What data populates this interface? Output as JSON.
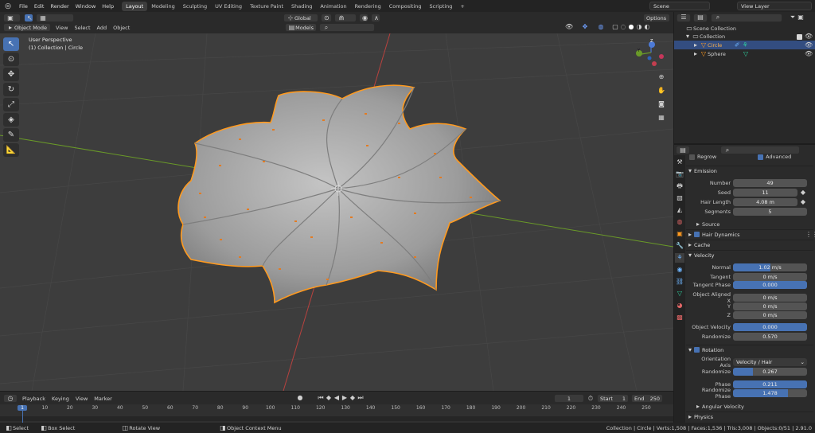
{
  "menubar": {
    "items": [
      "File",
      "Edit",
      "Render",
      "Window",
      "Help"
    ],
    "workspaces": [
      "Layout",
      "Modeling",
      "Sculpting",
      "UV Editing",
      "Texture Paint",
      "Shading",
      "Animation",
      "Rendering",
      "Compositing",
      "Scripting"
    ],
    "active_workspace": "Layout",
    "scene": "Scene",
    "view_layer": "View Layer"
  },
  "viewport_header": {
    "mode": "Object Mode",
    "menus": [
      "View",
      "Select",
      "Add",
      "Object"
    ],
    "orientation": "Global",
    "options": "Options",
    "collection_filter": "Models"
  },
  "viewport": {
    "perspective": "User Perspective",
    "collection_info": "(1) Collection | Circle",
    "gizmo_z": "Z",
    "gizmo_y": "Y"
  },
  "outliner": {
    "root": "Scene Collection",
    "collection": "Collection",
    "objects": [
      "Circle",
      "Sphere"
    ]
  },
  "properties": {
    "regrow": "Regrow",
    "advanced": "Advanced",
    "emission_title": "Emission",
    "emission": [
      {
        "label": "Number",
        "value": "49"
      },
      {
        "label": "Seed",
        "value": "11"
      },
      {
        "label": "Hair Length",
        "value": "4.08 m"
      },
      {
        "label": "Segments",
        "value": "5"
      }
    ],
    "source": "Source",
    "hair_dynamics": "Hair Dynamics",
    "cache": "Cache",
    "velocity_title": "Velocity",
    "velocity": [
      {
        "label": "Normal",
        "value": "1.02 m/s",
        "fill": 0.5
      },
      {
        "label": "Tangent",
        "value": "0 m/s",
        "fill": 0
      },
      {
        "label": "Tangent Phase",
        "value": "0.000",
        "fill": 1
      },
      {
        "label": "Object Aligned X",
        "value": "0 m/s",
        "fill": 0
      },
      {
        "label": "Y",
        "value": "0 m/s",
        "fill": 0
      },
      {
        "label": "Z",
        "value": "0 m/s",
        "fill": 0
      },
      {
        "label": "Object Velocity",
        "value": "0.000",
        "fill": 1
      },
      {
        "label": "Randomize",
        "value": "0.570",
        "fill": 0
      }
    ],
    "rotation_title": "Rotation",
    "orientation_axis_label": "Orientation Axis",
    "orientation_axis": "Velocity / Hair",
    "rotation": [
      {
        "label": "Randomize",
        "value": "0.267",
        "fill": 0.267
      },
      {
        "label": "Phase",
        "value": "0.211",
        "fill": 1
      },
      {
        "label": "Randomize Phase",
        "value": "1.478",
        "fill": 0.74
      }
    ],
    "angular_velocity": "Angular Velocity",
    "physics": "Physics"
  },
  "timeline": {
    "menus": [
      "Playback",
      "Keying",
      "View",
      "Marker"
    ],
    "current_frame": "1",
    "start_label": "Start",
    "start": "1",
    "end_label": "End",
    "end": "250",
    "ticks": [
      "1",
      "10",
      "20",
      "30",
      "40",
      "50",
      "60",
      "70",
      "80",
      "90",
      "100",
      "110",
      "120",
      "130",
      "140",
      "150",
      "160",
      "170",
      "180",
      "190",
      "200",
      "210",
      "220",
      "230",
      "240",
      "250"
    ]
  },
  "statusbar": {
    "select": "Select",
    "box_select": "Box Select",
    "rotate_view": "Rotate View",
    "context_menu": "Object Context Menu",
    "stats": "Collection | Circle | Verts:1,508 | Faces:1,536 | Tris:3,008 | Objects:0/51 | 2.91.0"
  },
  "colors": {
    "accent": "#4772b3",
    "selection": "#ff9a1f",
    "axis_x": "#b8423f",
    "axis_y": "#6a9a28"
  }
}
